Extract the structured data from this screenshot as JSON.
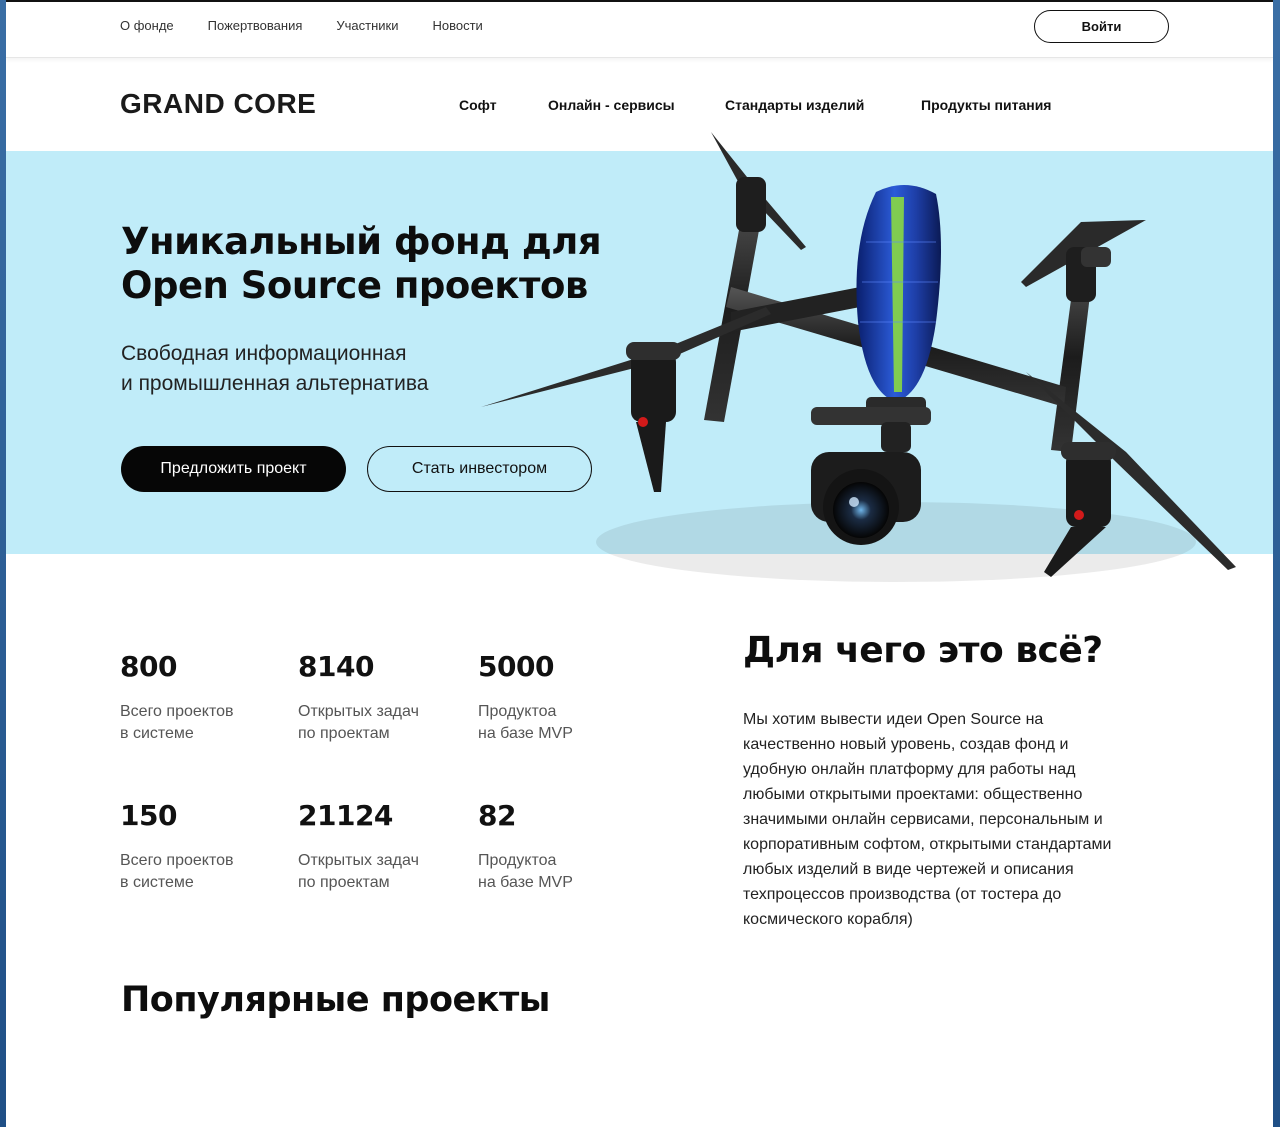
{
  "topbar": {
    "nav": [
      "О фонде",
      "Пожертвования",
      "Участники",
      "Новости"
    ],
    "login_label": "Войти"
  },
  "header": {
    "logo": "GRAND CORE",
    "nav": [
      "Софт",
      "Онлайн - сервисы",
      "Стандарты изделий",
      "Продукты питания"
    ]
  },
  "hero": {
    "title_lines": [
      "Уникальный фонд для",
      "Open Source проектов"
    ],
    "subtitle_lines": [
      "Свободная информационная",
      "и промышленная альтернатива"
    ],
    "primary_button": "Предложить проект",
    "secondary_button": "Стать инвестором",
    "background_color": "#c0ecf9",
    "image_icon": "drone-image"
  },
  "stats": [
    {
      "value": "800",
      "label_lines": [
        "Всего проектов",
        "в системе"
      ]
    },
    {
      "value": "8140",
      "label_lines": [
        "Открытых задач",
        "по проектам"
      ]
    },
    {
      "value": "5000",
      "label_lines": [
        "Продуктоа",
        "на базе MVP"
      ]
    },
    {
      "value": "150",
      "label_lines": [
        "Всего проектов",
        "в системе"
      ]
    },
    {
      "value": "21124",
      "label_lines": [
        "Открытых задач",
        "по проектам"
      ]
    },
    {
      "value": "82",
      "label_lines": [
        "Продуктоа",
        "на базе MVP"
      ]
    }
  ],
  "why": {
    "title": "Для чего это всё?",
    "text_lines": [
      "Мы хотим вывести идеи Open Source на",
      "качественно новый уровень, создав фонд и",
      "удобную онлайн платформу для работы над",
      "любыми открытыми проектами: общественно",
      "значимыми онлайн сервисами, персональным и",
      "корпоративным софтом, открытыми стандартами",
      "любых изделий в виде чертежей и описания",
      "техпроцессов производства (от тостера до",
      "космического корабля)"
    ]
  },
  "popular": {
    "title": "Популярные проекты"
  }
}
